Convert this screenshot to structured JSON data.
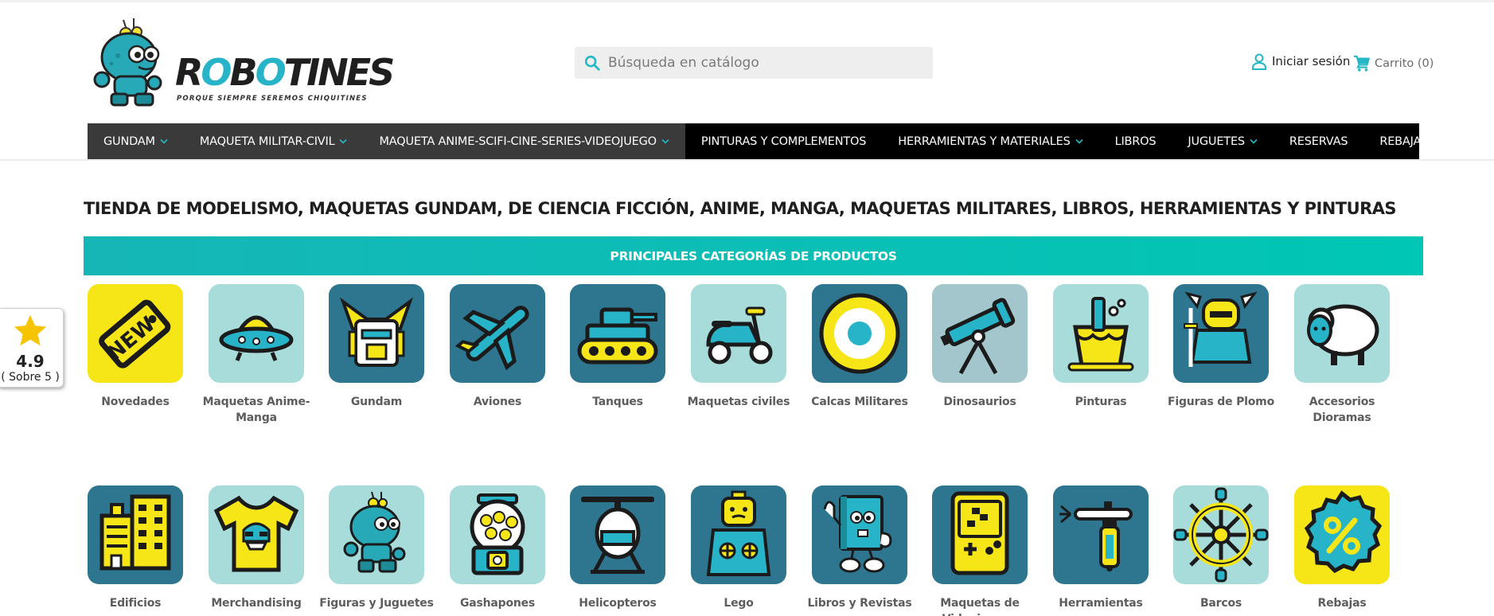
{
  "header": {
    "logo_text": "ROBOTINES",
    "logo_tagline": "PORQUE SIEMPRE SEREMOS CHIQUITINES",
    "search_placeholder": "Búsqueda en catálogo",
    "signin_label": "Iniciar sesión",
    "cart_label": "Carrito (0)"
  },
  "nav": {
    "items": [
      {
        "label": "GUNDAM",
        "dropdown": true,
        "dark": true
      },
      {
        "label": "MAQUETA MILITAR-CIVIL",
        "dropdown": true,
        "dark": true
      },
      {
        "label": "MAQUETA ANIME-SCIFI-CINE-SERIES-VIDEOJUEGO",
        "dropdown": true,
        "dark": true
      },
      {
        "label": "PINTURAS Y COMPLEMENTOS",
        "dropdown": false,
        "dark": false
      },
      {
        "label": "HERRAMIENTAS Y MATERIALES",
        "dropdown": true,
        "dark": false
      },
      {
        "label": "LIBROS",
        "dropdown": false,
        "dark": false
      },
      {
        "label": "JUGUETES",
        "dropdown": true,
        "dark": false
      },
      {
        "label": "RESERVAS",
        "dropdown": false,
        "dark": false
      },
      {
        "label": "REBAJAS",
        "dropdown": false,
        "dark": false
      }
    ]
  },
  "main": {
    "page_title": "TIENDA DE MODELISMO, MAQUETAS GUNDAM, DE CIENCIA FICCIÓN, ANIME, MANGA, MAQUETAS MILITARES, LIBROS, HERRAMIENTAS Y PINTURAS",
    "categories_heading": "PRINCIPALES CATEGORÍAS DE PRODUCTOS",
    "categories": [
      {
        "label": "Novedades",
        "icon": "new-tag-icon",
        "bg": "#f7e617"
      },
      {
        "label": "Maquetas Anime-Manga",
        "icon": "ufo-icon",
        "bg": "#a7dcdb"
      },
      {
        "label": "Gundam",
        "icon": "gundam-head-icon",
        "bg": "#2e7590"
      },
      {
        "label": "Aviones",
        "icon": "airplane-icon",
        "bg": "#2e7590"
      },
      {
        "label": "Tanques",
        "icon": "tank-icon",
        "bg": "#2e7590"
      },
      {
        "label": "Maquetas civiles",
        "icon": "scooter-icon",
        "bg": "#a7dcdb"
      },
      {
        "label": "Calcas Militares",
        "icon": "roundel-icon",
        "bg": "#2e7590"
      },
      {
        "label": "Dinosaurios",
        "icon": "telescope-icon",
        "bg": "#a3c6cc"
      },
      {
        "label": "Pinturas",
        "icon": "paint-bucket-icon",
        "bg": "#a7dcdb"
      },
      {
        "label": "Figuras de Plomo",
        "icon": "knight-icon",
        "bg": "#2e7590"
      },
      {
        "label": "Accesorios Dioramas",
        "icon": "sheep-icon",
        "bg": "#a7dcdb"
      },
      {
        "label": "Edificios",
        "icon": "buildings-icon",
        "bg": "#2e7590"
      },
      {
        "label": "Merchandising",
        "icon": "tshirt-icon",
        "bg": "#a7dcdb"
      },
      {
        "label": "Figuras y Juguetes",
        "icon": "robot-icon",
        "bg": "#a7dcdb"
      },
      {
        "label": "Gashapones",
        "icon": "gashapon-icon",
        "bg": "#a7dcdb"
      },
      {
        "label": "Helicopteros",
        "icon": "helicopter-icon",
        "bg": "#2e7590"
      },
      {
        "label": "Lego",
        "icon": "lego-figure-icon",
        "bg": "#2e7590"
      },
      {
        "label": "Libros y Revistas",
        "icon": "book-character-icon",
        "bg": "#2e7590"
      },
      {
        "label": "Maquetas de Videojuegos",
        "icon": "gameboy-icon",
        "bg": "#2e7590"
      },
      {
        "label": "Herramientas",
        "icon": "airbrush-icon",
        "bg": "#2e7590"
      },
      {
        "label": "Barcos",
        "icon": "ship-wheel-icon",
        "bg": "#a7dcdb"
      },
      {
        "label": "Rebajas",
        "icon": "discount-badge-icon",
        "bg": "#f7e617"
      }
    ]
  },
  "rating": {
    "score": "4.9",
    "subtitle": "( Sobre 5 )"
  },
  "colors": {
    "accent": "#25b7c4",
    "nav_bg": "#000000",
    "nav_dark_bg": "#3a3a3a",
    "tile_label": "#5d5d5d"
  }
}
